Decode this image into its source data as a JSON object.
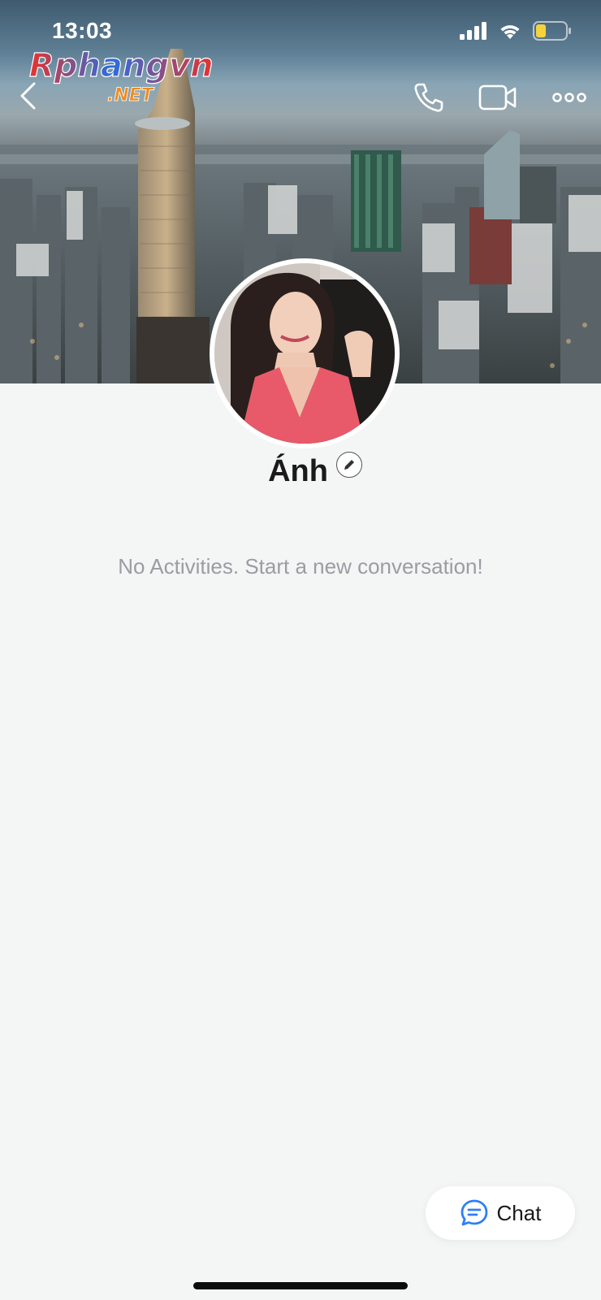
{
  "status_bar": {
    "time": "13:03"
  },
  "watermark": {
    "text_main": "Rphangvn",
    "text_sub": ".NET"
  },
  "header": {
    "back_icon": "chevron-left-icon",
    "call_icon": "phone-icon",
    "video_icon": "video-camera-icon",
    "more_icon": "more-horizontal-icon"
  },
  "profile": {
    "name": "Ánh",
    "edit_icon": "pencil-icon",
    "empty_message": "No Activities. Start a new conversation!"
  },
  "chat_button": {
    "label": "Chat",
    "icon": "chat-bubble-icon",
    "icon_color": "#2f7ff5"
  },
  "colors": {
    "accent": "#2f7ff5",
    "background": "#f4f5f5",
    "muted_text": "#9a9da2"
  }
}
